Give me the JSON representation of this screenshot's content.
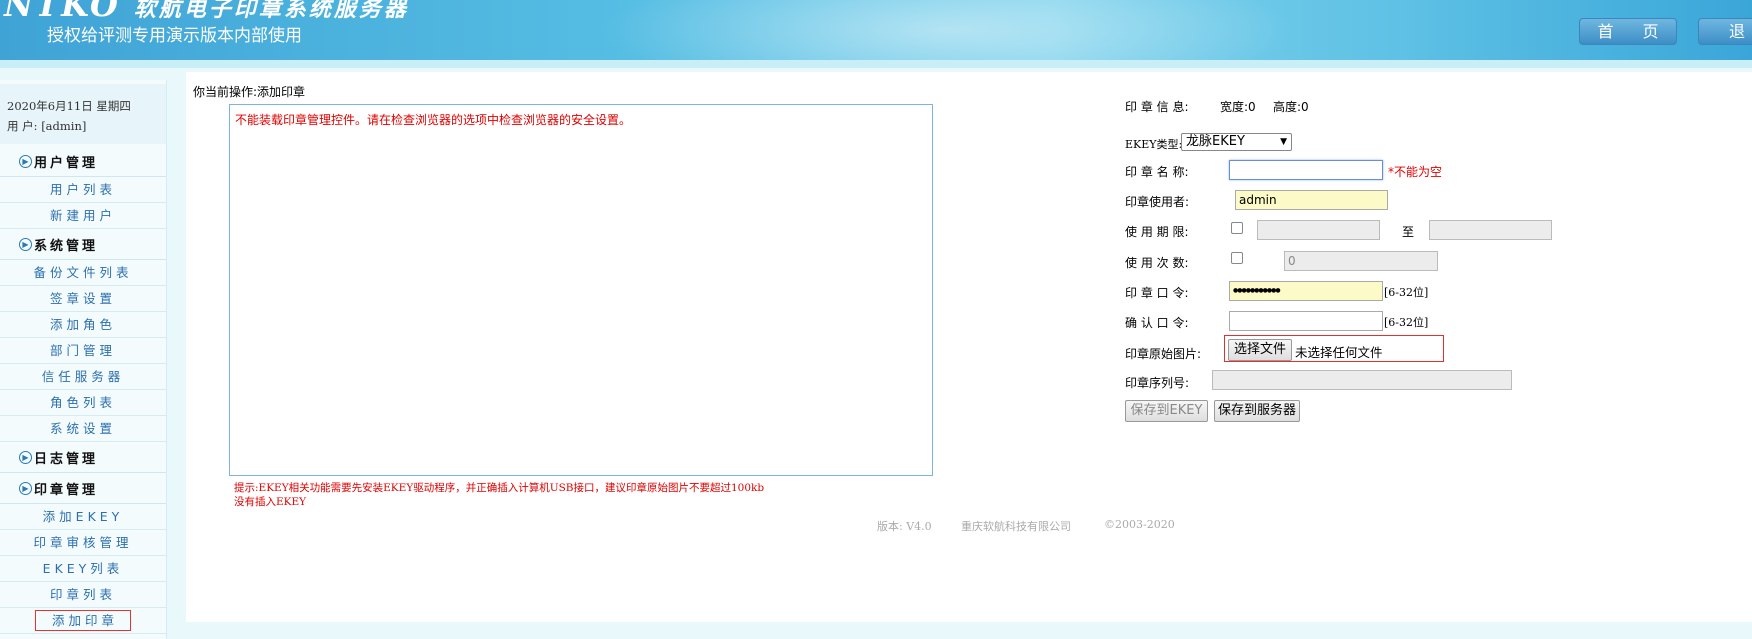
{
  "header": {
    "logo_text": "NTKO",
    "logo_sub": "软航电子印章系统服务器",
    "subtitle": "授权给评测专用演示版本内部使用",
    "home_label": "首 页",
    "exit_label": "退"
  },
  "sidebar": {
    "date": "2020年6月11日 星期四",
    "user_label": "用  户:",
    "user_value": "[admin]",
    "sections": [
      {
        "label": "用户管理",
        "items": [
          "用户列表",
          "新建用户"
        ]
      },
      {
        "label": "系统管理",
        "items": [
          "备份文件列表",
          "签章设置",
          "添加角色",
          "部门管理",
          "信任服务器",
          "角色列表",
          "系统设置"
        ]
      },
      {
        "label": "日志管理",
        "items": []
      },
      {
        "label": "印章管理",
        "items": [
          "添加EKEY",
          "印章审核管理",
          "EKEY列表",
          "印章列表",
          "添加印章"
        ]
      }
    ],
    "active_item": "添加印章"
  },
  "main": {
    "breadcrumb": "你当前操作:添加印章",
    "control_error": "不能装载印章管理控件。请在检查浏览器的选项中检查浏览器的安全设置。",
    "hint_line1": "提示:EKEY相关功能需要先安装EKEY驱动程序，并正确插入计算机USB接口，建议印章原始图片不要超过100kb",
    "hint_line2": "没有插入EKEY"
  },
  "form": {
    "info_label": "印 章 信 息:",
    "width_text": "宽度:0",
    "height_text": "高度:0",
    "ekey_type_label": "EKEY类型:",
    "ekey_type_value": "龙脉EKEY",
    "name_label": "印 章 名 称:",
    "name_value": "",
    "name_required": "*不能为空",
    "user_label": "印章使用者:",
    "user_value": "admin",
    "period_label": "使 用 期 限:",
    "period_to": "至",
    "count_label": "使 用 次 数:",
    "count_value": "0",
    "password_label": "印 章 口 令:",
    "password_value": "●●●●●●●●●●●",
    "password_hint": "[6-32位]",
    "confirm_label": "确 认 口 令:",
    "confirm_value": "",
    "confirm_hint": "[6-32位]",
    "image_label": "印章原始图片:",
    "file_button": "选择文件",
    "file_status": "未选择任何文件",
    "serial_label": "印章序列号:",
    "serial_value": "",
    "save_ekey": "保存到EKEY",
    "save_server": "保存到服务器"
  },
  "footer": {
    "version": "版本: V4.0",
    "company": "重庆软航科技有限公司",
    "copyright": "©2003-2020"
  }
}
